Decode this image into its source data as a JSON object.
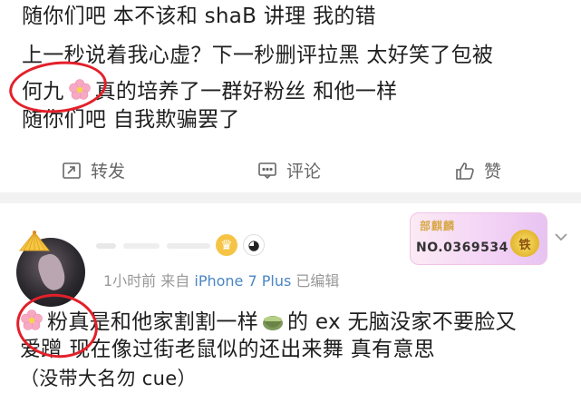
{
  "post": {
    "lines": [
      "随你们吧 本不该和 shaB 讲理 我的错",
      "上一秒说着我心虚？下一秒删评拉黑 太好笑了包被",
      "真的培养了一群好粉丝 和他一样",
      "随你们吧 自我欺骗罢了"
    ],
    "line3_prefix": "何九",
    "actions": {
      "repost": "转发",
      "comment": "评论",
      "like": "赞"
    }
  },
  "comment": {
    "badge_card": {
      "name": "部麒麟",
      "number": "NO.0369534",
      "medal": "铁"
    },
    "meta": {
      "time": "1小时前",
      "from": "来自",
      "device": "iPhone 7 Plus",
      "edited": "已编辑"
    },
    "text": {
      "line1_a": "粉",
      "line1_b": "真是和他家割割一样",
      "line1_c": "的 ex  无脑没家不要脸又",
      "line2": "爱蹭  现在像过街老鼠似的还出来舞  真有意思",
      "line3": "（没带大名勿 cue）"
    }
  },
  "colors": {
    "annotation_red": "#e3202a",
    "meta_blue": "#4a86c5",
    "action_gray": "#666666"
  },
  "icons": [
    "flower-emoji-icon",
    "repost-icon",
    "comment-icon",
    "like-icon",
    "fan-icon",
    "crown-badge-icon",
    "panda-badge-icon",
    "tea-emoji-icon",
    "chevron-down-icon"
  ]
}
